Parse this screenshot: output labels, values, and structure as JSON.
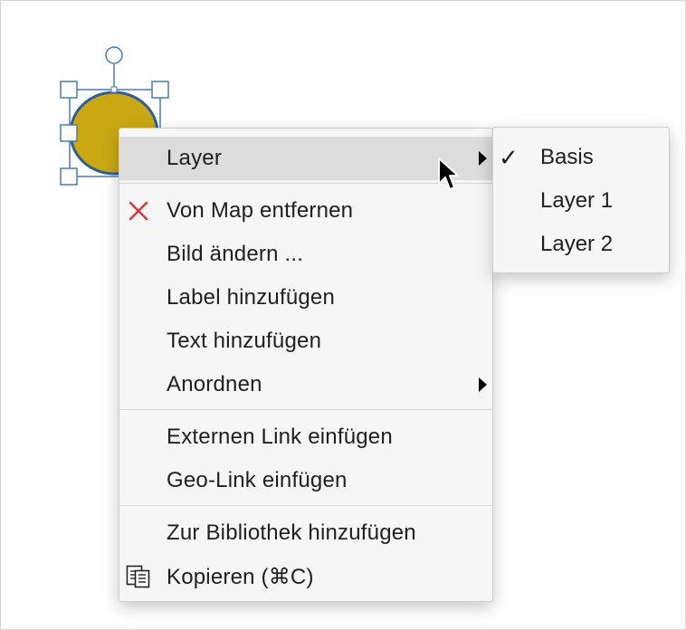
{
  "context_menu": {
    "items": [
      {
        "label": "Layer",
        "icon": "",
        "has_submenu": true,
        "highlighted": true
      },
      {
        "label": "Von Map entfernen",
        "icon": "red-x-icon",
        "has_submenu": false
      },
      {
        "label": "Bild ändern ...",
        "icon": "",
        "has_submenu": false
      },
      {
        "label": "Label hinzufügen",
        "icon": "",
        "has_submenu": false
      },
      {
        "label": "Text hinzufügen",
        "icon": "",
        "has_submenu": false
      },
      {
        "label": "Anordnen",
        "icon": "",
        "has_submenu": true
      },
      {
        "label": "Externen Link einfügen",
        "icon": "",
        "has_submenu": false
      },
      {
        "label": "Geo-Link einfügen",
        "icon": "",
        "has_submenu": false
      },
      {
        "label": "Zur Bibliothek hinzufügen",
        "icon": "",
        "has_submenu": false
      },
      {
        "label": "Kopieren (⌘C)",
        "icon": "copy-icon",
        "has_submenu": false
      }
    ]
  },
  "layer_submenu": {
    "items": [
      {
        "label": "Basis",
        "checked": true,
        "check_glyph": "✓"
      },
      {
        "label": "Layer 1",
        "checked": false
      },
      {
        "label": "Layer 2",
        "checked": false
      }
    ]
  },
  "colors": {
    "shape_fill": "#C9A814",
    "shape_stroke": "#2F5D9A",
    "handle_stroke": "#4A7BB5",
    "remove_icon": "#D93A3A",
    "menu_highlight": "#DCDCDC"
  }
}
